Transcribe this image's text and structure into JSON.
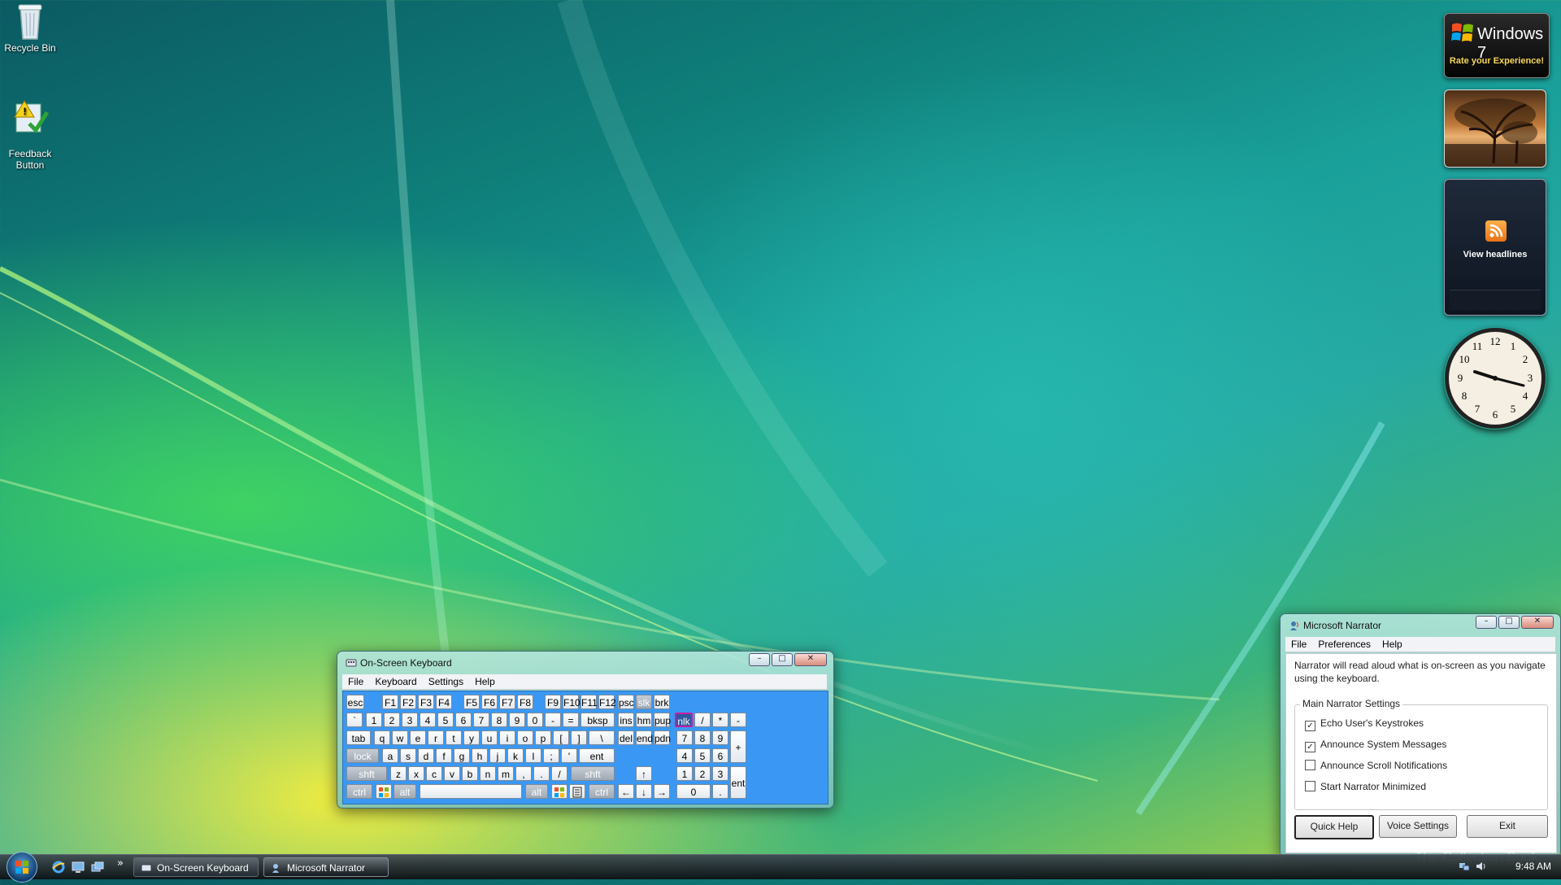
{
  "desktop": {
    "icons": [
      {
        "label": "Recycle Bin"
      },
      {
        "label": "Feedback\nButton"
      }
    ]
  },
  "gadgets": {
    "win7": {
      "title": "Windows 7",
      "subtitle": "Rate your Experience!"
    },
    "feed": {
      "label": "View headlines"
    },
    "clock": {
      "numbers": [
        "12",
        "1",
        "2",
        "3",
        "4",
        "5",
        "6",
        "7",
        "8",
        "9",
        "10",
        "11"
      ]
    }
  },
  "osk": {
    "title": "On-Screen Keyboard",
    "menu": [
      "File",
      "Keyboard",
      "Settings",
      "Help"
    ],
    "rows": [
      [
        "esc",
        "F1",
        "F2",
        "F3",
        "F4",
        "F5",
        "F6",
        "F7",
        "F8",
        "F9",
        "F10",
        "F11",
        "F12",
        "psc",
        "slk",
        "brk"
      ],
      [
        "`",
        "1",
        "2",
        "3",
        "4",
        "5",
        "6",
        "7",
        "8",
        "9",
        "0",
        "-",
        "=",
        "bksp",
        "ins",
        "hm",
        "pup",
        "nlk",
        "/",
        "*",
        "-"
      ],
      [
        "tab",
        "q",
        "w",
        "e",
        "r",
        "t",
        "y",
        "u",
        "i",
        "o",
        "p",
        "[",
        "]",
        "\\",
        "del",
        "end",
        "pdn",
        "7",
        "8",
        "9",
        "+"
      ],
      [
        "lock",
        "a",
        "s",
        "d",
        "f",
        "g",
        "h",
        "j",
        "k",
        "l",
        ";",
        "'",
        "ent",
        "4",
        "5",
        "6"
      ],
      [
        "shft",
        "z",
        "x",
        "c",
        "v",
        "b",
        "n",
        "m",
        ",",
        ".",
        "/",
        "shft",
        "↑",
        "1",
        "2",
        "3",
        "ent"
      ],
      [
        "ctrl",
        "alt",
        "alt",
        "ctrl",
        "←",
        "↓",
        "→",
        "0",
        "."
      ]
    ]
  },
  "narrator": {
    "title": "Microsoft Narrator",
    "menu": [
      "File",
      "Preferences",
      "Help"
    ],
    "description": "Narrator will read aloud what is on-screen as you navigate using the keyboard.",
    "group_title": "Main Narrator Settings",
    "options": [
      {
        "label": "Echo User's Keystrokes",
        "checked": true
      },
      {
        "label": "Announce System Messages",
        "checked": true
      },
      {
        "label": "Announce Scroll Notifications",
        "checked": false
      },
      {
        "label": "Start Narrator Minimized",
        "checked": false
      }
    ],
    "buttons": {
      "quick_help": "Quick Help",
      "voice_settings": "Voice Settings",
      "exit": "Exit"
    }
  },
  "taskbar": {
    "items": [
      "On-Screen Keyboard",
      "Microsoft Narrator"
    ],
    "time": "9:48 AM",
    "overflow": "»"
  },
  "watermark": "The Collection Book",
  "colors": {
    "key_area": "#3a98f4",
    "highlight_key": "#c81ea0"
  }
}
